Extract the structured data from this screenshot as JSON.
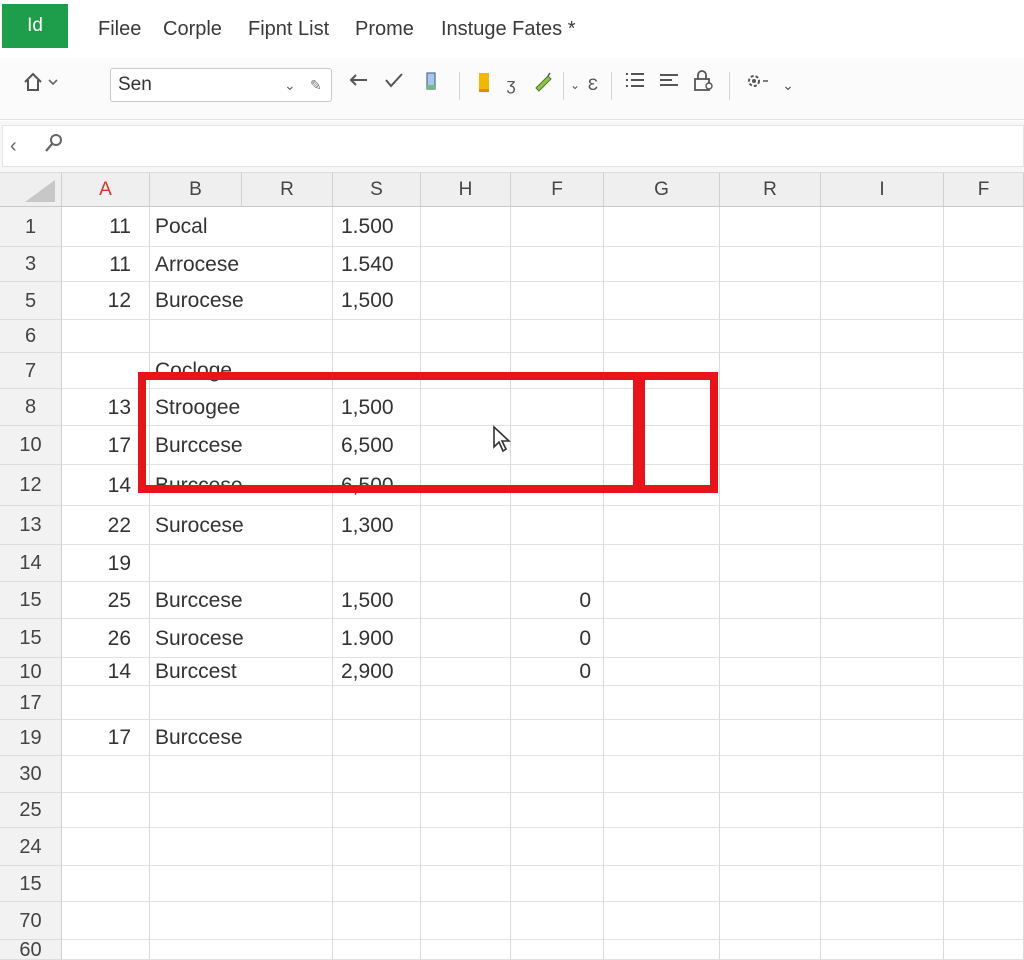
{
  "app": {
    "logo_text": "Id",
    "logo_color": "#1e9e4a",
    "menu": [
      "Filee",
      "Corple",
      "Fipnt List",
      "Prome",
      "Instuge Fates *"
    ]
  },
  "toolbar": {
    "home_icon": "house-icon",
    "font_name": "Sen",
    "font_chevron": "⌄",
    "font_extra": "✎",
    "icons": [
      "undo-icon",
      "check-icon",
      "paint-bucket-icon",
      "fill-color-icon",
      "s-icon",
      "pen-icon",
      "dropdown-icon",
      "e-icon",
      "list-icon",
      "align-icon",
      "lock-icon",
      "gear-icon",
      "more-icon"
    ]
  },
  "formula_bar": {
    "back_icon": "chevron-left-icon",
    "search_icon": "search-icon"
  },
  "columns": [
    "A",
    "B",
    "R",
    "S",
    "H",
    "F",
    "G",
    "R",
    "I",
    "F"
  ],
  "active_column_color": "#e0332d",
  "rows": [
    {
      "label": "1",
      "a": "11",
      "b": "Pocal",
      "s": "1.500",
      "f": ""
    },
    {
      "label": "3",
      "a": "11",
      "b": "Arrocese",
      "s": "1.540",
      "f": ""
    },
    {
      "label": "5",
      "a": "12",
      "b": "Burocese",
      "s": "1,500",
      "f": ""
    },
    {
      "label": "6",
      "a": "",
      "b": "",
      "s": "",
      "f": ""
    },
    {
      "label": "7",
      "a": "",
      "b": "Coclоge",
      "s": "",
      "f": ""
    },
    {
      "label": "8",
      "a": "13",
      "b": "Stroogee",
      "s": "1,500",
      "f": ""
    },
    {
      "label": "10",
      "a": "17",
      "b": "Burccese",
      "s": "6,500",
      "f": ""
    },
    {
      "label": "12",
      "a": "14",
      "b": "Burccese",
      "s": "6,500",
      "f": ""
    },
    {
      "label": "13",
      "a": "22",
      "b": "Surocese",
      "s": "1,300",
      "f": ""
    },
    {
      "label": "14",
      "a": "19",
      "b": "",
      "s": "",
      "f": ""
    },
    {
      "label": "15",
      "a": "25",
      "b": "Burccese",
      "s": "1,500",
      "f": "0"
    },
    {
      "label": "15",
      "a": "26",
      "b": "Surocese",
      "s": "1.900",
      "f": "0"
    },
    {
      "label": "10",
      "a": "14",
      "b": "Burccest",
      "s": "2,900",
      "f": "0"
    },
    {
      "label": "17",
      "a": "",
      "b": "",
      "s": "",
      "f": ""
    },
    {
      "label": "19",
      "a": "17",
      "b": "Burccese",
      "s": "",
      "f": ""
    },
    {
      "label": "30",
      "a": "",
      "b": "",
      "s": "",
      "f": ""
    },
    {
      "label": "25",
      "a": "",
      "b": "",
      "s": "",
      "f": ""
    },
    {
      "label": "24",
      "a": "",
      "b": "",
      "s": "",
      "f": ""
    },
    {
      "label": "15",
      "a": "",
      "b": "",
      "s": "",
      "f": ""
    },
    {
      "label": "70",
      "a": "",
      "b": "",
      "s": "",
      "f": ""
    },
    {
      "label": "60",
      "a": "",
      "b": "",
      "s": "",
      "f": ""
    }
  ],
  "highlight_color": "#e8141c"
}
